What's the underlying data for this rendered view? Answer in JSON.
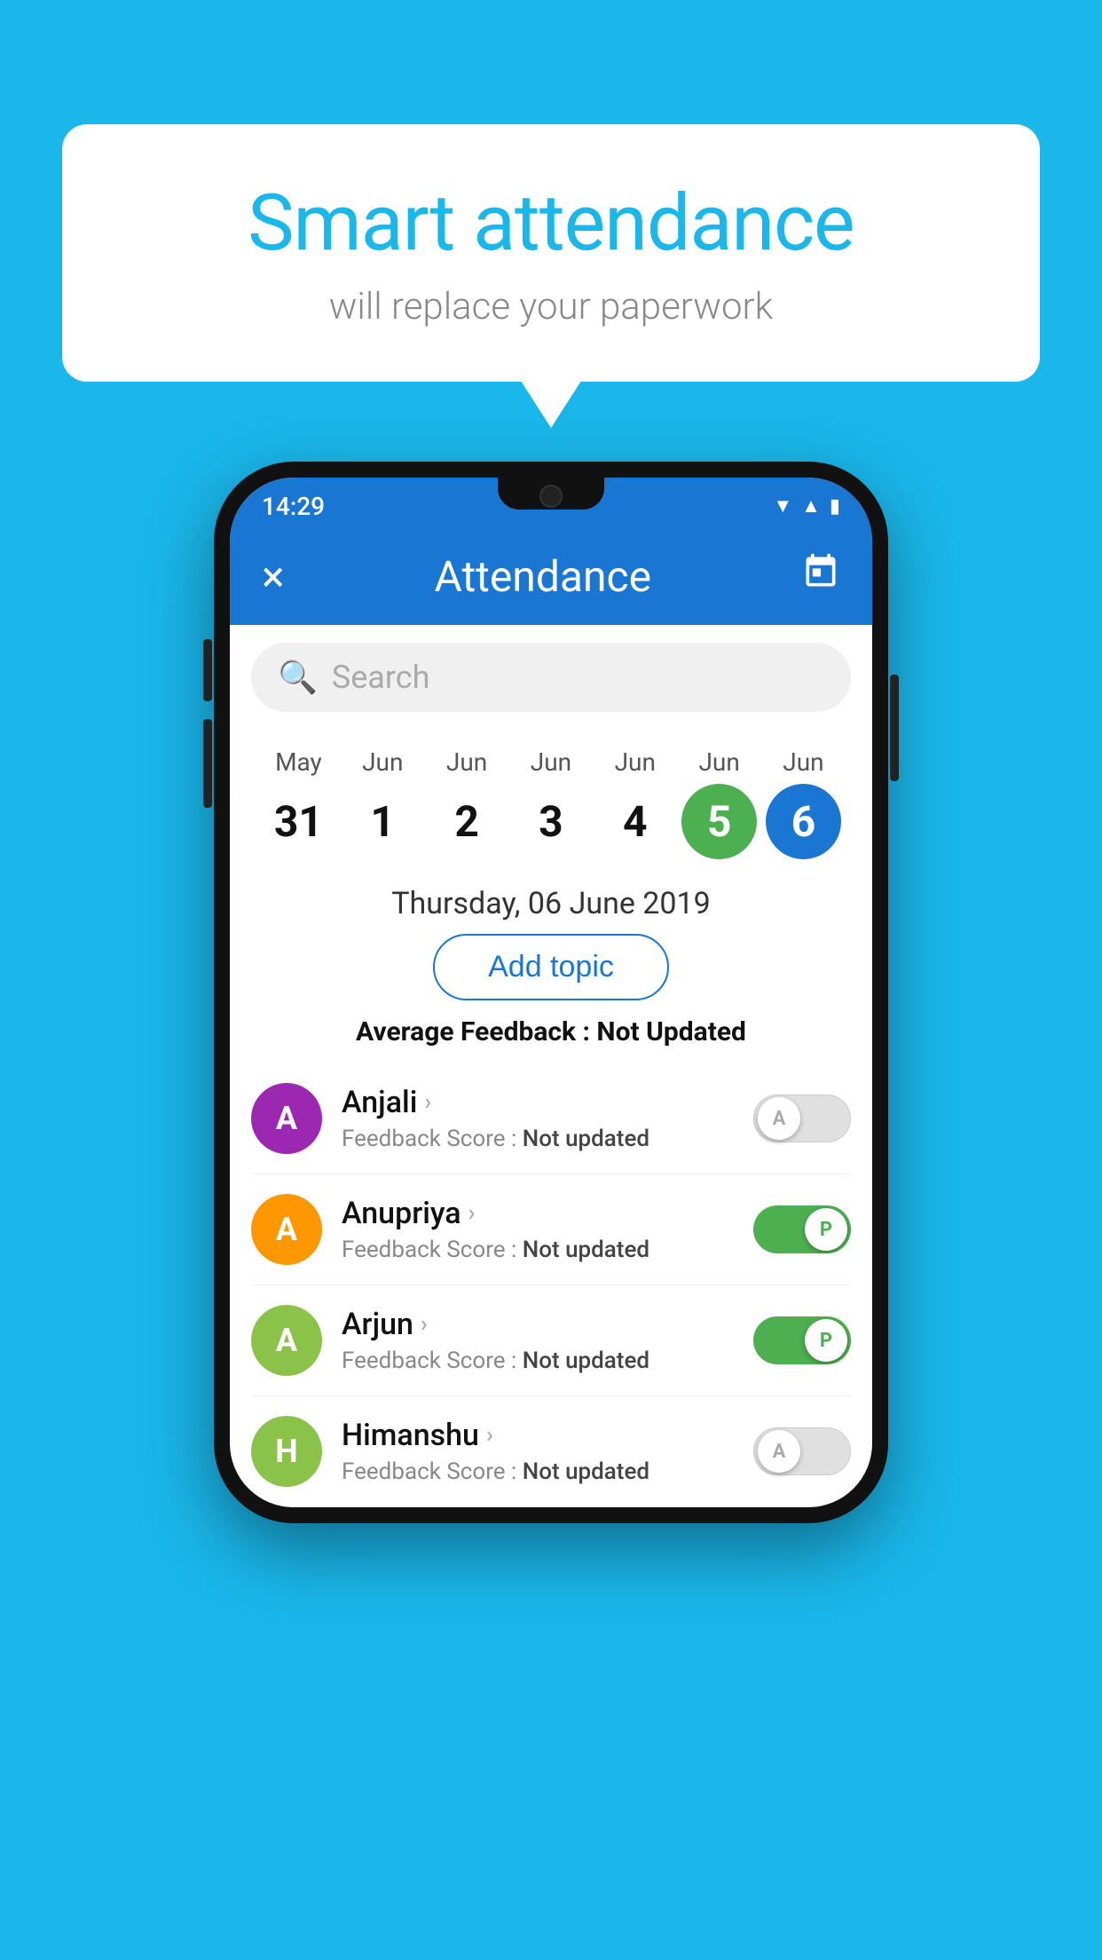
{
  "page": {
    "background_color": "#1ab7ea"
  },
  "speech_bubble": {
    "title": "Smart attendance",
    "subtitle": "will replace your paperwork"
  },
  "status_bar": {
    "time": "14:29",
    "icons": [
      "wifi",
      "signal",
      "battery"
    ]
  },
  "app_bar": {
    "title": "Attendance",
    "close_label": "×",
    "calendar_label": "📅"
  },
  "search": {
    "placeholder": "Search"
  },
  "calendar": {
    "days": [
      {
        "month": "May",
        "num": "31",
        "state": "normal"
      },
      {
        "month": "Jun",
        "num": "1",
        "state": "normal"
      },
      {
        "month": "Jun",
        "num": "2",
        "state": "normal"
      },
      {
        "month": "Jun",
        "num": "3",
        "state": "normal"
      },
      {
        "month": "Jun",
        "num": "4",
        "state": "normal"
      },
      {
        "month": "Jun",
        "num": "5",
        "state": "today"
      },
      {
        "month": "Jun",
        "num": "6",
        "state": "selected"
      }
    ],
    "selected_date_label": "Thursday, 06 June 2019"
  },
  "add_topic_btn": "Add topic",
  "avg_feedback": {
    "label": "Average Feedback : ",
    "value": "Not Updated"
  },
  "students": [
    {
      "name": "Anjali",
      "initial": "A",
      "avatar_color": "purple",
      "feedback_label": "Feedback Score : ",
      "feedback_value": "Not updated",
      "attendance": "absent",
      "toggle_letter": "A"
    },
    {
      "name": "Anupriya",
      "initial": "A",
      "avatar_color": "orange",
      "feedback_label": "Feedback Score : ",
      "feedback_value": "Not updated",
      "attendance": "present",
      "toggle_letter": "P"
    },
    {
      "name": "Arjun",
      "initial": "A",
      "avatar_color": "green",
      "feedback_label": "Feedback Score : ",
      "feedback_value": "Not updated",
      "attendance": "present",
      "toggle_letter": "P"
    },
    {
      "name": "Himanshu",
      "initial": "H",
      "avatar_color": "lime",
      "feedback_label": "Feedback Score : ",
      "feedback_value": "Not updated",
      "attendance": "absent",
      "toggle_letter": "A"
    }
  ]
}
